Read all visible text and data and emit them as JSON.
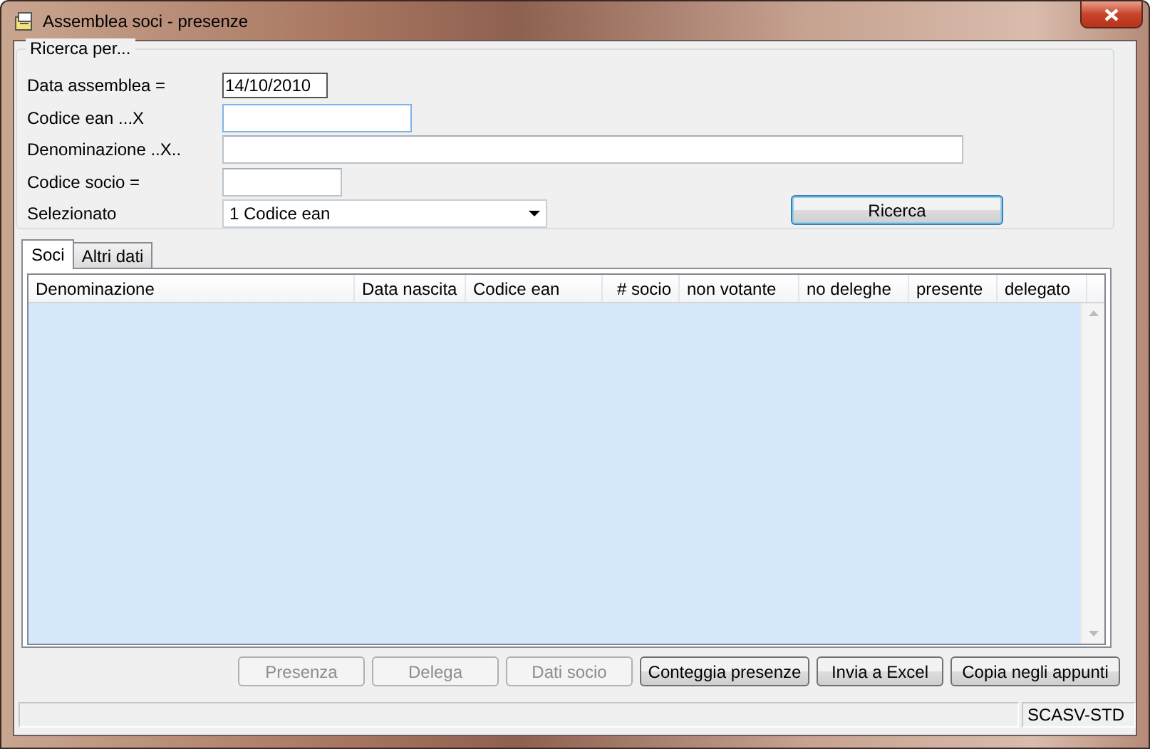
{
  "window": {
    "title": "Assemblea soci - presenze"
  },
  "search": {
    "legend": "Ricerca per...",
    "fields": [
      {
        "label": "Data assemblea =",
        "value": "14/10/2010",
        "kind": "date"
      },
      {
        "label": "Codice ean ...X",
        "kind": "focused"
      },
      {
        "label": "Denominazione ..X..",
        "kind": "wide"
      },
      {
        "label": "Codice socio =",
        "kind": "short"
      },
      {
        "label": "Selezionato",
        "value": "1 Codice ean",
        "kind": "dropdown"
      }
    ],
    "button": "Ricerca"
  },
  "tabs": [
    {
      "label": "Soci",
      "selected": true
    },
    {
      "label": "Altri dati",
      "selected": false
    }
  ],
  "table": {
    "columns": [
      {
        "label": "Denominazione",
        "kind": "text"
      },
      {
        "label": "Data nascita",
        "kind": "text"
      },
      {
        "label": "Codice ean",
        "kind": "text"
      },
      {
        "label": "# socio",
        "kind": "number"
      },
      {
        "label": "non votante",
        "kind": "text"
      },
      {
        "label": "no deleghe",
        "kind": "text"
      },
      {
        "label": "presente",
        "kind": "text"
      },
      {
        "label": "delegato",
        "kind": "text"
      }
    ]
  },
  "buttons": [
    {
      "label": "Presenza",
      "disabled": true
    },
    {
      "label": "Delega",
      "disabled": true
    },
    {
      "label": "Dati socio",
      "disabled": true
    },
    {
      "label": "Conteggia presenze",
      "disabled": false
    },
    {
      "label": "Invia a Excel",
      "disabled": false
    },
    {
      "label": "Copia negli appunti",
      "disabled": false
    }
  ],
  "status_bar": {
    "panel": "SCASV-STD"
  }
}
